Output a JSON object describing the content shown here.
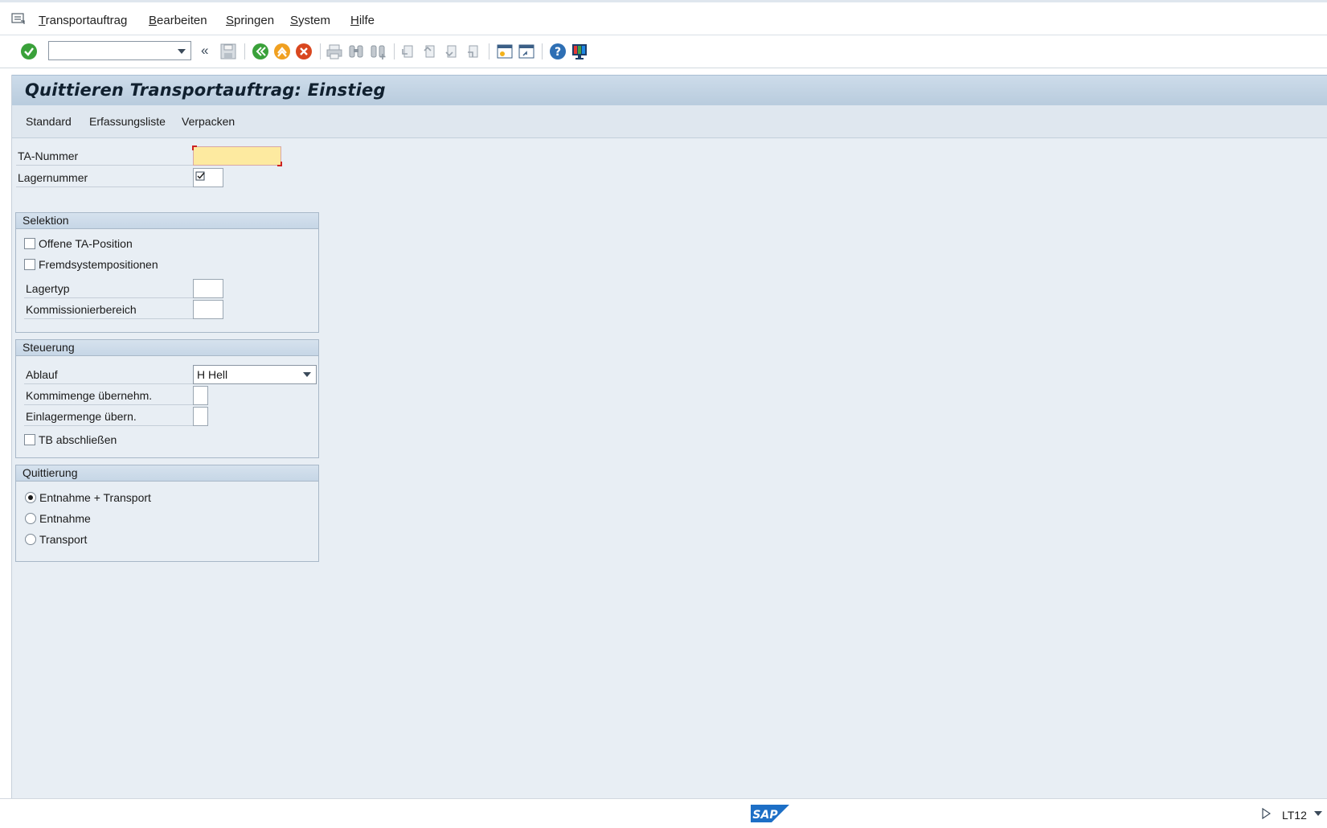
{
  "menu": {
    "items": [
      {
        "u": "T",
        "rest": "ransportauftrag"
      },
      {
        "u": "B",
        "rest": "earbeiten"
      },
      {
        "u": "S",
        "rest": "pringen"
      },
      {
        "u": "S",
        "rest": "ystem"
      },
      {
        "u": "H",
        "rest": "ilfe"
      }
    ]
  },
  "toolbar": {
    "command_value": ""
  },
  "title": "Quittieren Transportauftrag: Einstieg",
  "appbar": {
    "standard": "Standard",
    "erfassungsliste": "Erfassungsliste",
    "verpacken": "Verpacken"
  },
  "form": {
    "ta_nummer_label": "TA-Nummer",
    "ta_nummer_value": "",
    "lagernummer_label": "Lagernummer",
    "lagernummer_value": ""
  },
  "selektion": {
    "header": "Selektion",
    "offene_ta_position": "Offene TA-Position",
    "fremdsystempositionen": "Fremdsystempositionen",
    "lagertyp_label": "Lagertyp",
    "lagertyp_value": "",
    "kommissionierbereich_label": "Kommissionierbereich",
    "kommissionierbereich_value": ""
  },
  "steuerung": {
    "header": "Steuerung",
    "ablauf_label": "Ablauf",
    "ablauf_value": "H Hell",
    "kommimenge_label": "Kommimenge übernehm.",
    "kommimenge_value": "",
    "einlagermenge_label": "Einlagermenge übern.",
    "einlagermenge_value": "",
    "tb_abschliessen": "TB abschließen"
  },
  "quittierung": {
    "header": "Quittierung",
    "options": [
      "Entnahme + Transport",
      "Entnahme",
      "Transport"
    ],
    "selected": 0
  },
  "status": {
    "logo_text": "SAP",
    "tcode": "LT12"
  },
  "colors": {
    "accent_green": "#3aa13a",
    "orange": "#f0a020",
    "cancel_red": "#d9471f",
    "help_blue": "#2e6fb4"
  }
}
